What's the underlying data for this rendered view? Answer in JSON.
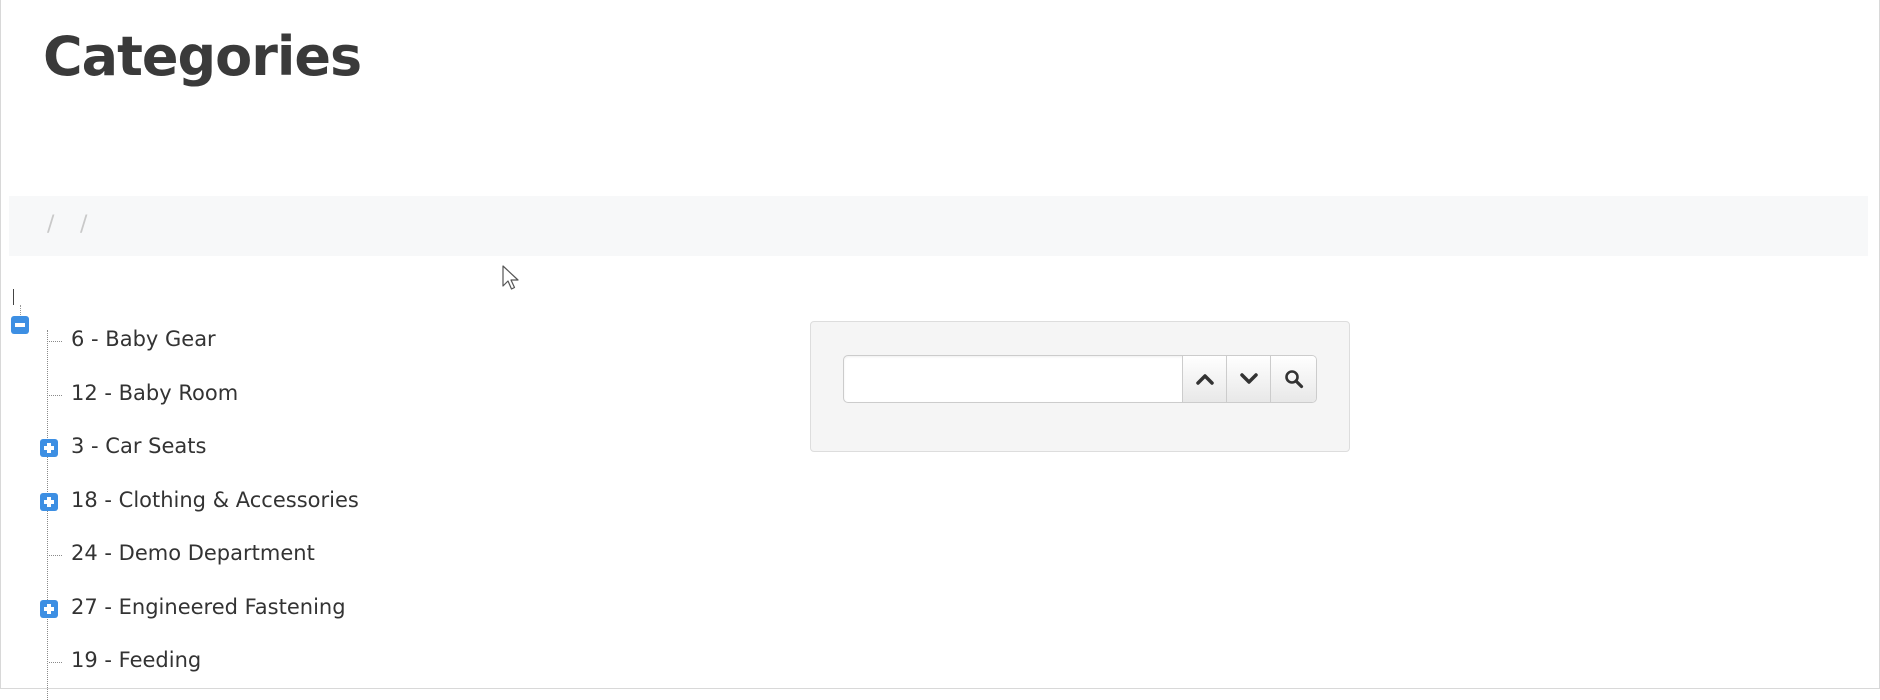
{
  "page": {
    "title": "Categories"
  },
  "breadcrumb": {
    "separators": [
      "/",
      "/"
    ]
  },
  "tree": {
    "root": {
      "expanded": true,
      "toggle_icon": "minus-icon"
    },
    "items": [
      {
        "label": "6 - Baby Gear",
        "has_children": false
      },
      {
        "label": "12 - Baby Room",
        "has_children": false
      },
      {
        "label": "3 - Car Seats",
        "has_children": true
      },
      {
        "label": "18 - Clothing & Accessories",
        "has_children": true
      },
      {
        "label": "24 - Demo Department",
        "has_children": false
      },
      {
        "label": "27 - Engineered Fastening",
        "has_children": true
      },
      {
        "label": "19 - Feeding",
        "has_children": false
      }
    ]
  },
  "search": {
    "value": "",
    "placeholder": "",
    "buttons": [
      "chevron-up-icon",
      "chevron-down-icon",
      "search-icon"
    ]
  },
  "colors": {
    "accent": "#3d8fe3",
    "title": "#3a3a3a",
    "panel_bg": "#f5f5f5",
    "breadcrumb_bg": "#f7f8f9"
  }
}
